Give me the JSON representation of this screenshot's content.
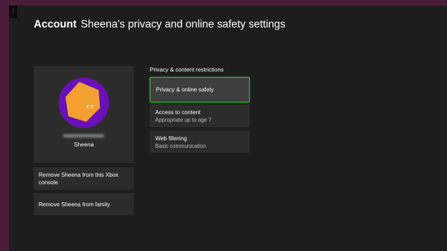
{
  "header": {
    "section": "Account",
    "title": "Sheena's privacy and online safety settings"
  },
  "profile": {
    "name": "Sheena",
    "avatar_bg": "#6a10b8",
    "avatar_shape": "#f4a030"
  },
  "actions": [
    {
      "label": "Remove Sheena from this Xbox console"
    },
    {
      "label": "Remove Sheena from family"
    }
  ],
  "restrictions": {
    "heading": "Privacy & content restrictions",
    "items": [
      {
        "label": "Privacy & online safety",
        "sub": ""
      },
      {
        "label": "Access to content",
        "sub": "Appropriate up to age 7"
      },
      {
        "label": "Web filtering",
        "sub": "Basic communication"
      }
    ]
  },
  "colors": {
    "focus": "#2fd52f",
    "background": "#1d1d1d",
    "tile": "#2c2c2c"
  }
}
